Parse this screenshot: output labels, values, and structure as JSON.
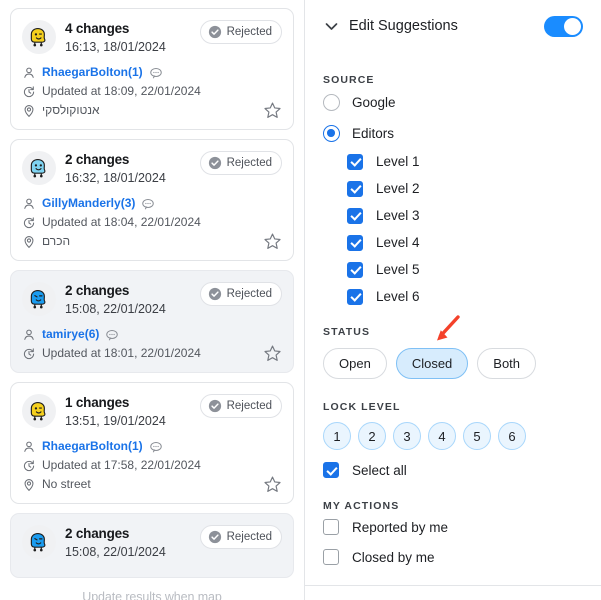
{
  "list": {
    "cards": [
      {
        "avatar": "waze-mood-yellow-happy",
        "changes": "4 changes",
        "date": "16:13, 18/01/2024",
        "status": "Rejected",
        "user": "RhaegarBolton(1)",
        "updated": "Updated at 18:09, 22/01/2024",
        "location": "אנטוקולסקי",
        "has_location": true,
        "selected": false
      },
      {
        "avatar": "waze-mood-lightblue-happy",
        "changes": "2 changes",
        "date": "16:32, 18/01/2024",
        "status": "Rejected",
        "user": "GillyManderly(3)",
        "updated": "Updated at 18:04, 22/01/2024",
        "location": "הכרם",
        "has_location": true,
        "selected": false
      },
      {
        "avatar": "waze-mood-blue-wink",
        "changes": "2 changes",
        "date": "15:08, 22/01/2024",
        "status": "Rejected",
        "user": "tamirye(6)",
        "updated": "Updated at 18:01, 22/01/2024",
        "location": "",
        "has_location": false,
        "selected": true
      },
      {
        "avatar": "waze-mood-yellow-happy",
        "changes": "1 changes",
        "date": "13:51, 19/01/2024",
        "status": "Rejected",
        "user": "RhaegarBolton(1)",
        "updated": "Updated at 17:58, 22/01/2024",
        "location": "No street",
        "has_location": true,
        "selected": false
      },
      {
        "avatar": "waze-mood-blue-wink",
        "changes": "2 changes",
        "date": "15:08, 22/01/2024",
        "status": "Rejected",
        "user": "",
        "updated": "",
        "location": "",
        "has_location": false,
        "selected": true
      }
    ],
    "hint": "Update results when map"
  },
  "filters": {
    "header": {
      "title": "Edit Suggestions",
      "toggle_on": true
    },
    "source": {
      "title": "SOURCE",
      "options": [
        {
          "label": "Google",
          "checked": false
        },
        {
          "label": "Editors",
          "checked": true
        }
      ],
      "levels": [
        {
          "label": "Level 1",
          "checked": true
        },
        {
          "label": "Level 2",
          "checked": true
        },
        {
          "label": "Level 3",
          "checked": true
        },
        {
          "label": "Level 4",
          "checked": true
        },
        {
          "label": "Level 5",
          "checked": true
        },
        {
          "label": "Level 6",
          "checked": true
        }
      ]
    },
    "status": {
      "title": "STATUS",
      "options": [
        {
          "label": "Open",
          "active": false
        },
        {
          "label": "Closed",
          "active": true
        },
        {
          "label": "Both",
          "active": false
        }
      ]
    },
    "lock_level": {
      "title": "LOCK LEVEL",
      "levels": [
        "1",
        "2",
        "3",
        "4",
        "5",
        "6"
      ],
      "select_all": {
        "label": "Select all",
        "checked": true
      }
    },
    "my_actions": {
      "title": "MY ACTIONS",
      "options": [
        {
          "label": "Reported by me",
          "checked": false
        },
        {
          "label": "Closed by me",
          "checked": false
        }
      ]
    }
  },
  "colors": {
    "accent": "#1a73e8",
    "toggle_on": "#1a8cff",
    "pill_active_bg": "#d7ecfd",
    "annotation_arrow": "#f4412a"
  }
}
